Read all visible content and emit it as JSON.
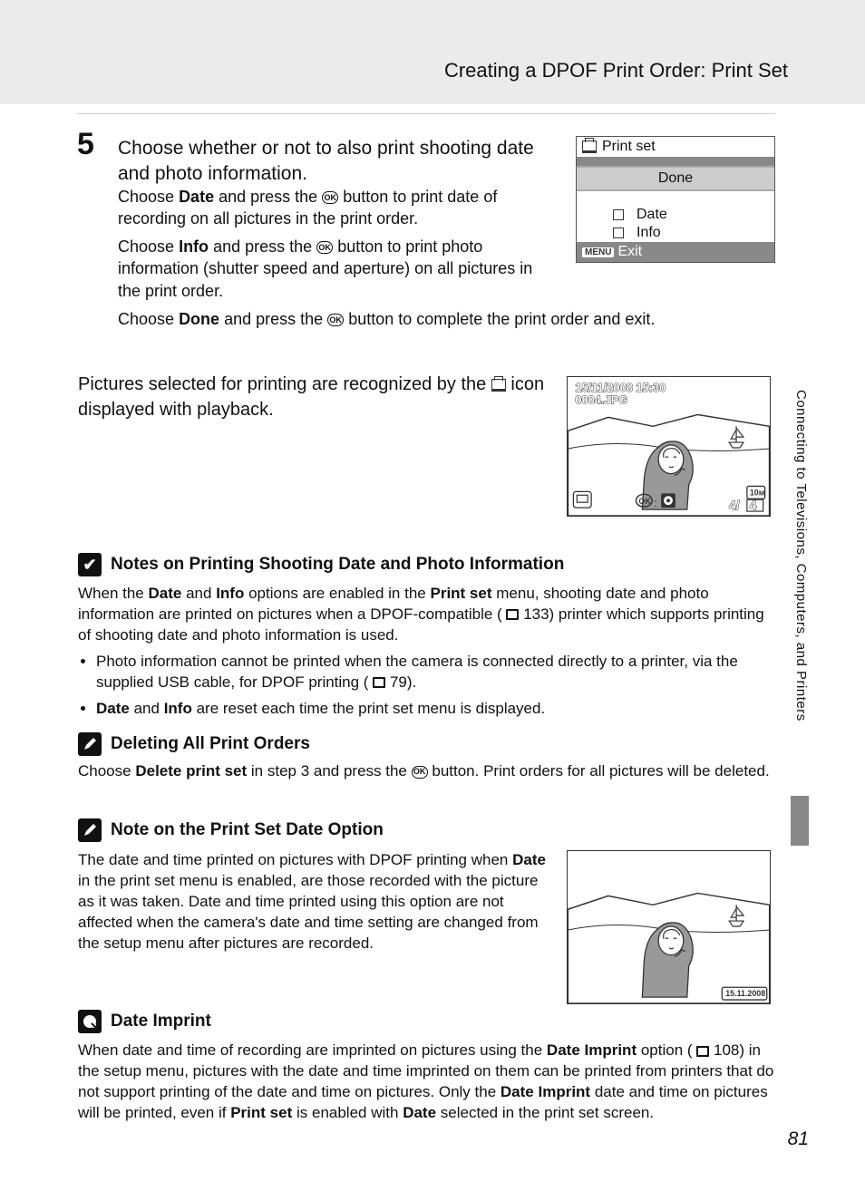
{
  "header": {
    "title": "Creating a DPOF Print Order: Print Set"
  },
  "icons": {
    "ok": "OK"
  },
  "step": {
    "number": "5",
    "title": "Choose whether or not to also print shooting date and photo information.",
    "p1": {
      "a": "Choose",
      "b": "Date",
      "c": "and press the",
      "d": "button to print date of recording on all pictures in the print order."
    },
    "p2": {
      "a": "Choose",
      "b": "Info",
      "c": "and press the",
      "d": "button to print photo information (shutter speed and aperture) on all pictures in the print order."
    },
    "p3": {
      "a": "Choose",
      "b": "Done",
      "c": "and press the",
      "d": "button to complete the print order and exit."
    },
    "p4": {
      "a": "Pictures selected for printing are recognized by the",
      "b": "icon displayed with playback."
    }
  },
  "printset": {
    "title": "Print set",
    "done": "Done",
    "date": "Date",
    "info": "Info",
    "menu": "MENU",
    "exit": "Exit"
  },
  "playback": {
    "datetime": "15/11/2008 15:30",
    "filename": "0004.JPG",
    "counter": "4/    4",
    "size_badge": "10M",
    "date_stamp": "15.11.2008"
  },
  "sections": [
    {
      "title": "Notes on Printing Shooting Date and Photo Information",
      "body": {
        "a": "When the",
        "b": "Date",
        "c": "and",
        "d": "Info",
        "e": "options are enabled in the",
        "f": "Print set",
        "g": "menu, shooting date and photo information are printed on pictures when a DPOF-compatible (",
        "h": "133) printer which supports printing of shooting date and photo information is used."
      },
      "bullets": [
        {
          "a": "Photo information cannot be printed when the camera is connected directly to a printer, via the supplied USB cable, for DPOF printing (",
          "b": "79)."
        },
        {
          "a": "Date",
          "b": "and",
          "c": "Info",
          "d": "are reset each time the print set menu is displayed."
        }
      ]
    },
    {
      "title": "Deleting All Print Orders",
      "body": {
        "a": "Choose",
        "b": "Delete print set",
        "c": "in step 3 and press the",
        "d": "button. Print orders for all pictures will be deleted."
      }
    },
    {
      "title": {
        "a": "Note on the Print Set",
        "b": "Date",
        "c": "Option"
      },
      "body": {
        "a": "The date and time printed on pictures with DPOF printing when",
        "b": "Date",
        "c": "in the print set menu is enabled, are those recorded with the picture as it was taken. Date and time printed using this option are not affected when the camera's date and time setting are changed from the setup menu after pictures are recorded."
      }
    },
    {
      "title": "Date Imprint",
      "body": {
        "a": "When date and time of recording are imprinted on pictures using the",
        "b": "Date Imprint",
        "c": "option (",
        "d": "108) in the setup menu, pictures with the date and time imprinted on them can be printed from printers that do not support printing of the date and time on pictures. Only the",
        "e": "Date Imprint",
        "f": "date and time on pictures will be printed, even if",
        "g": "Print set",
        "h": "is enabled with",
        "i": "Date",
        "j": "selected in the print set screen."
      }
    }
  ],
  "side": {
    "label": "Connecting to Televisions, Computers, and Printers"
  },
  "page": {
    "number": "81"
  }
}
